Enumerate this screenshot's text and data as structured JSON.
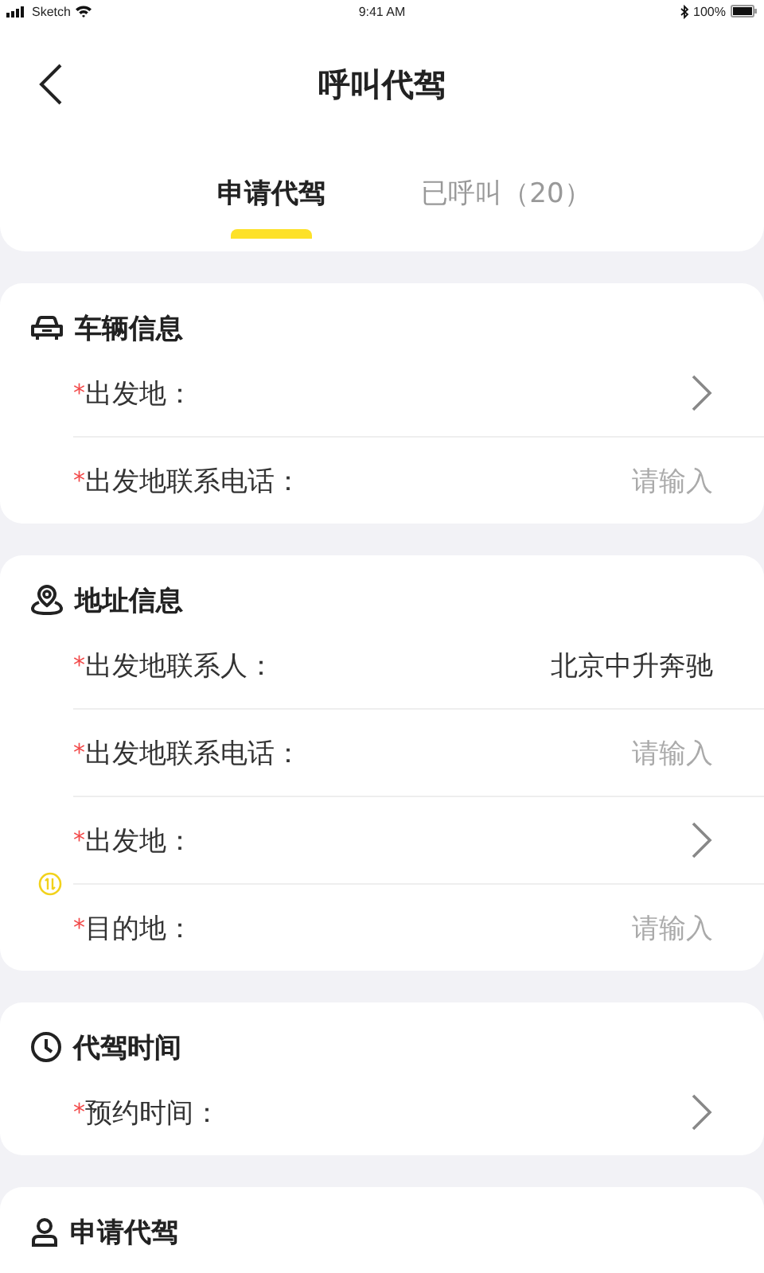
{
  "status_bar": {
    "carrier": "Sketch",
    "time": "9:41 AM",
    "battery": "100%"
  },
  "header": {
    "title": "呼叫代驾"
  },
  "tabs": [
    {
      "label": "申请代驾",
      "selected": true
    },
    {
      "label": "已呼叫（20）",
      "selected": false
    }
  ],
  "sections": [
    {
      "kind": "vehicle",
      "title": "车辆信息",
      "fields": [
        {
          "kind": "select",
          "mark": "*",
          "label": "出发地："
        },
        {
          "kind": "input",
          "mark": "*",
          "label": "出发地联系电话：",
          "placeholder": "请输入"
        }
      ]
    },
    {
      "kind": "address",
      "title": "地址信息",
      "fields": [
        {
          "kind": "input",
          "mark": "*",
          "label": "出发地联系人：",
          "value": "北京中升奔驰"
        },
        {
          "kind": "input",
          "mark": "*",
          "label": "出发地联系电话：",
          "placeholder": "请输入"
        },
        {
          "kind": "select",
          "mark": "*",
          "label": "出发地："
        },
        {
          "kind": "input",
          "mark": "*",
          "label": "目的地：",
          "placeholder": "请输入"
        }
      ]
    },
    {
      "kind": "time",
      "title": "代驾时间",
      "fields": [
        {
          "kind": "select",
          "mark": "*",
          "label": "预约时间："
        }
      ]
    },
    {
      "kind": "applicant",
      "title": "申请代驾"
    }
  ]
}
